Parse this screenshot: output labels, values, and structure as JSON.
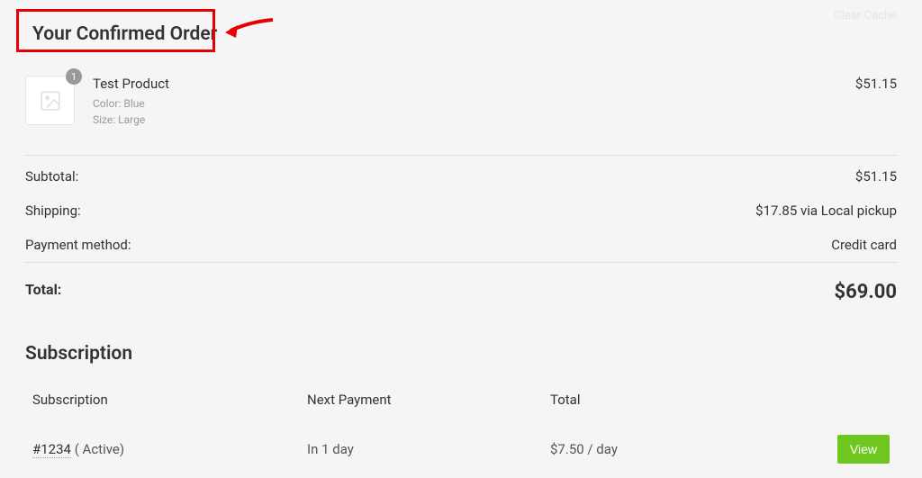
{
  "clear_cache_label": "Clear Cache",
  "page_title": "Your Confirmed Order",
  "product": {
    "qty": "1",
    "name": "Test Product",
    "meta_color": "Color: Blue",
    "meta_size": "Size: Large",
    "price": "$51.15"
  },
  "summary": {
    "subtotal_label": "Subtotal:",
    "subtotal_value": "$51.15",
    "shipping_label": "Shipping:",
    "shipping_value": "$17.85 via Local pickup",
    "payment_label": "Payment method:",
    "payment_value": "Credit card",
    "total_label": "Total:",
    "total_value": "$69.00"
  },
  "subscription": {
    "heading": "Subscription",
    "headers": {
      "subscription": "Subscription",
      "next_payment": "Next Payment",
      "total": "Total"
    },
    "row": {
      "id": "#1234",
      "status": " ( Active)",
      "next_payment": "In 1 day",
      "total": "$7.50 / day",
      "view_label": "View"
    }
  }
}
